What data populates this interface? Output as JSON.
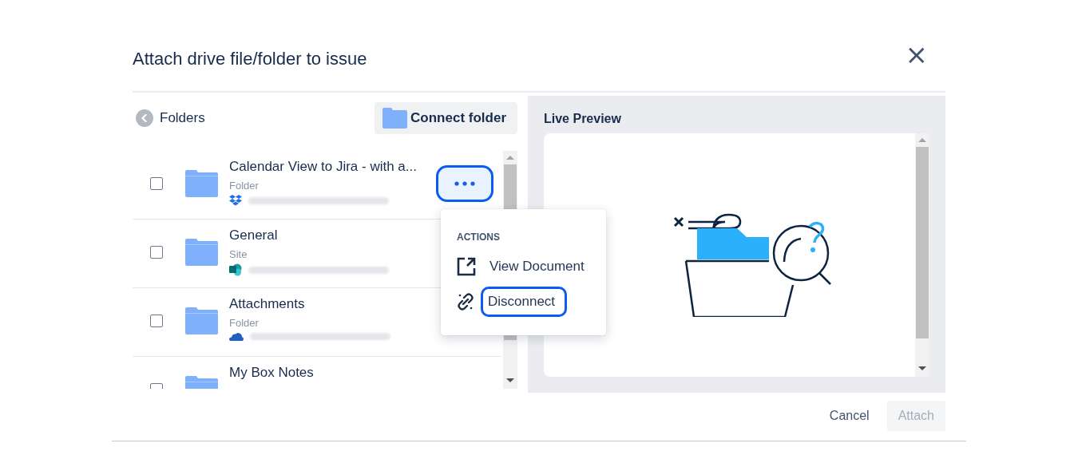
{
  "dialog": {
    "title": "Attach drive file/folder to issue",
    "close": "×"
  },
  "left_pane": {
    "back_label": "Folders",
    "connect_button": "Connect folder",
    "rows": [
      {
        "name": "Calendar View to Jira - with a...",
        "type": "Folder",
        "kind": "stacked-boxes",
        "checked": false,
        "focused": true
      },
      {
        "name": "General",
        "type": "Site",
        "kind": "s-badge",
        "checked": false,
        "focused": false
      },
      {
        "name": "Attachments",
        "type": "Folder",
        "kind": "cloud",
        "checked": false,
        "focused": false
      },
      {
        "name": "My Box Notes",
        "kind": "none",
        "checked": false,
        "focused": false
      }
    ]
  },
  "menu": {
    "heading": "ACTIONS",
    "items": [
      {
        "label": "View Document",
        "kind": "external",
        "focused": false
      },
      {
        "label": "Disconnect",
        "kind": "unlink",
        "focused": true
      }
    ]
  },
  "preview": {
    "title": "Live Preview"
  },
  "footer": {
    "cancel": "Cancel",
    "attach": "Attach",
    "attach_disabled": true
  }
}
